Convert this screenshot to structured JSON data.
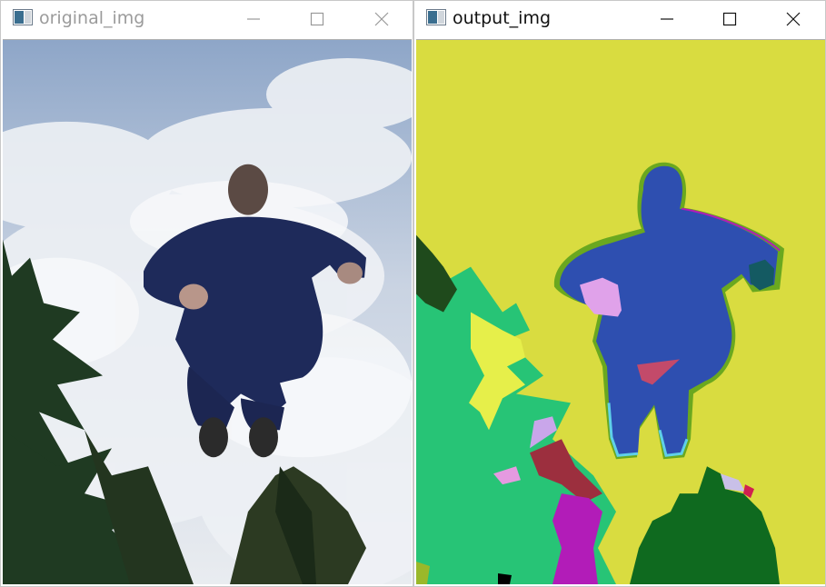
{
  "windows": [
    {
      "title": "original_img",
      "icon": "window-app-icon",
      "controls": [
        "minimize-icon",
        "maximize-icon",
        "close-icon"
      ],
      "inactive_title_color": "#9b9b9b"
    },
    {
      "title": "output_img",
      "icon": "window-app-icon",
      "controls": [
        "minimize-icon",
        "maximize-icon",
        "close-icon"
      ],
      "active_title_color": "#111111"
    }
  ],
  "colors": {
    "sky_blue": "#9fb4d0",
    "cloud_white": "#eef0f3",
    "person_navy": "#1e2a5a",
    "palm_dark": "#1f3a22",
    "seg_background": "#d9dc40",
    "seg_person": "#2e4fb0",
    "seg_green": "#27c476",
    "seg_darkgreen": "#0f6a1f",
    "seg_magenta": "#b21cb8",
    "seg_lightyellow": "#e6ef4a"
  }
}
